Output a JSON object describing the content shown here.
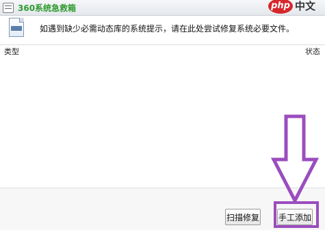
{
  "window": {
    "title": "360系统急救箱"
  },
  "watermark": {
    "logo": "php",
    "text": "中文网"
  },
  "info": {
    "message": "如遇到缺少必需动态库的系统提示，请在此处尝试修复系统必要文件。"
  },
  "table": {
    "columns": [
      "类型",
      "状态"
    ],
    "rows": []
  },
  "buttons": {
    "scan_repair": "扫描修复",
    "manual_add": "手工添加"
  },
  "colors": {
    "title": "#2f9a2f",
    "annotation": "#9b4dbe",
    "watermark_red": "#d7262b"
  }
}
